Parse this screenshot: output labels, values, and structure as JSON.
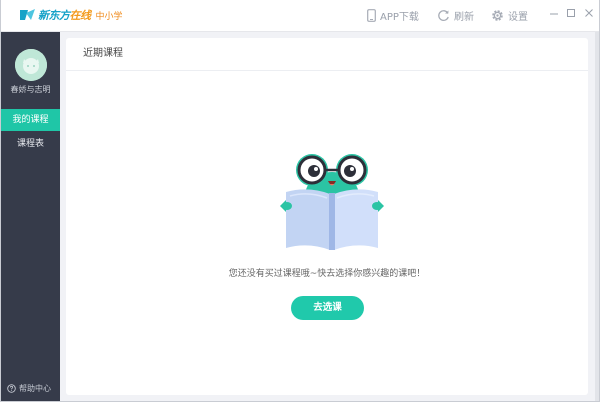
{
  "titlebar": {
    "brand_part1": "新东方",
    "brand_part2": "在线",
    "brand_sub": "中小学",
    "app_download": "APP下载",
    "refresh": "刷新",
    "settings": "设置"
  },
  "sidebar": {
    "username": "春娇与志明",
    "items": [
      {
        "label": "我的课程",
        "active": true
      },
      {
        "label": "课程表",
        "active": false
      }
    ],
    "help": "帮助中心"
  },
  "main": {
    "header": "近期课程",
    "empty_message": "您还没有买过课程哦~快去选择你感兴趣的课吧！",
    "cta": "去选课"
  },
  "colors": {
    "accent": "#1fc6a7",
    "sidebar_bg": "#363b4a",
    "brand_blue": "#16a2c8",
    "brand_orange": "#f39b1d"
  },
  "icons": [
    "logo-icon",
    "phone-icon",
    "refresh-icon",
    "gear-icon",
    "minimize-icon",
    "maximize-icon",
    "close-icon",
    "help-icon",
    "mascot-reading-icon"
  ]
}
